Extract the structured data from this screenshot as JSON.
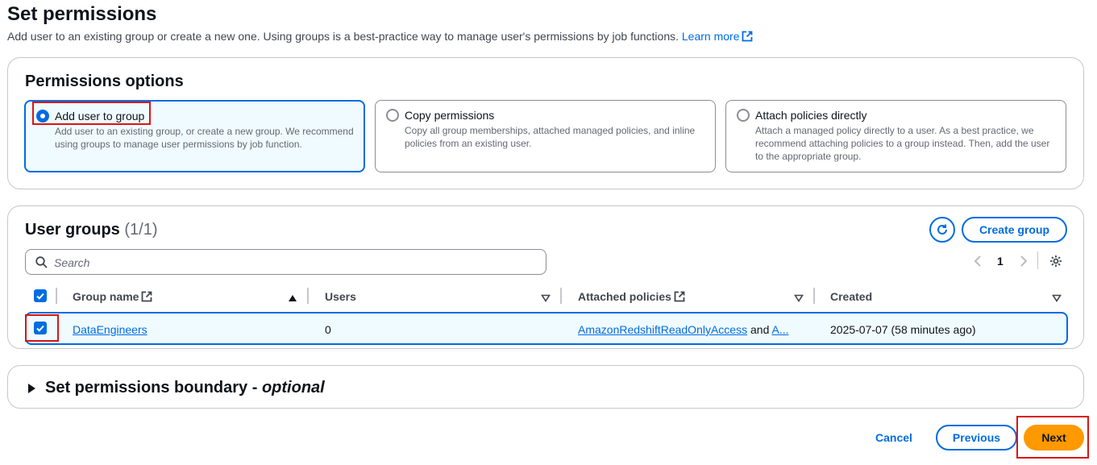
{
  "header": {
    "title": "Set permissions",
    "description": "Add user to an existing group or create a new one. Using groups is a best-practice way to manage user's permissions by job functions.",
    "learn_more": "Learn more"
  },
  "options": {
    "title": "Permissions options",
    "tiles": [
      {
        "label": "Add user to group",
        "description": "Add user to an existing group, or create a new group. We recommend using groups to manage user permissions by job function.",
        "selected": true
      },
      {
        "label": "Copy permissions",
        "description": "Copy all group memberships, attached managed policies, and inline policies from an existing user.",
        "selected": false
      },
      {
        "label": "Attach policies directly",
        "description": "Attach a managed policy directly to a user. As a best practice, we recommend attaching policies to a group instead. Then, add the user to the appropriate group.",
        "selected": false
      }
    ]
  },
  "groups": {
    "title": "User groups",
    "count": "(1/1)",
    "create_button": "Create group",
    "search_placeholder": "Search",
    "page": "1",
    "columns": [
      "Group name",
      "Users",
      "Attached policies",
      "Created"
    ],
    "rows": [
      {
        "name": "DataEngineers",
        "users": "0",
        "policy1": "AmazonRedshiftReadOnlyAccess",
        "and": "and",
        "policy2": "A...",
        "created": "2025-07-07 (58 minutes ago)",
        "checked": true
      }
    ]
  },
  "boundary": {
    "title": "Set permissions boundary - ",
    "optional": "optional"
  },
  "footer": {
    "cancel": "Cancel",
    "previous": "Previous",
    "next": "Next"
  },
  "colors": {
    "accent": "#006ce0",
    "primary_button": "#ff9900",
    "highlight_box": "#d91515",
    "selected_bg": "#f0fbff"
  }
}
